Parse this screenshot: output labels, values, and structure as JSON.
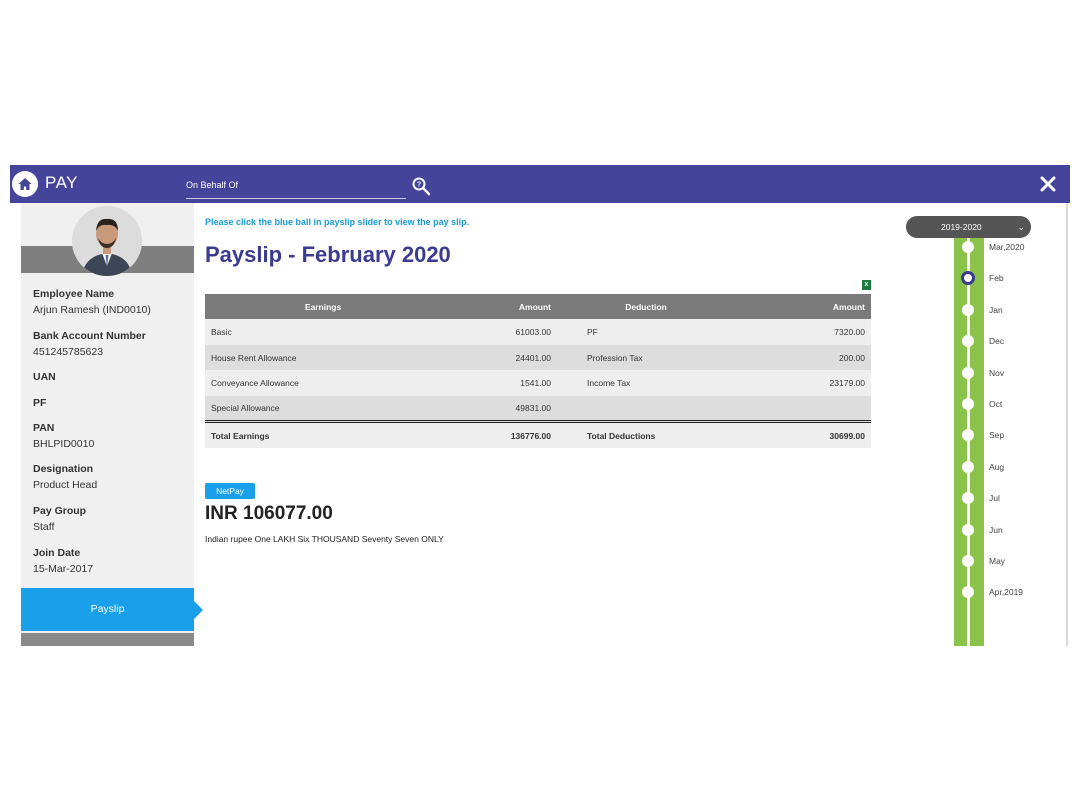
{
  "topbar": {
    "title": "PAY",
    "behalf_placeholder": "On Behalf Of",
    "home_icon": "home-icon",
    "search_icon": "search-icon",
    "close_icon": "close-icon",
    "color": "#44449a"
  },
  "profile": {
    "fields": [
      {
        "label": "Employee Name",
        "value": "Arjun Ramesh (IND0010)"
      },
      {
        "label": "Bank Account Number",
        "value": "451245785623"
      },
      {
        "label": "UAN",
        "value": ""
      },
      {
        "label": "PF",
        "value": ""
      },
      {
        "label": "PAN",
        "value": "BHLPID0010"
      },
      {
        "label": "Designation",
        "value": "Product Head"
      },
      {
        "label": "Pay Group",
        "value": "Staff"
      },
      {
        "label": "Join Date",
        "value": "15-Mar-2017"
      }
    ],
    "active_tab": "Payslip"
  },
  "main": {
    "hint": "Please click the blue ball in payslip slider to view the pay slip.",
    "title": "Payslip - February 2020",
    "table": {
      "headers": [
        "Earnings",
        "Amount",
        "Deduction",
        "Amount"
      ],
      "rows": [
        [
          "Basic",
          "61003.00",
          "PF",
          "7320.00"
        ],
        [
          "House Rent Allowance",
          "24401.00",
          "Profession Tax",
          "200.00"
        ],
        [
          "Conveyance Allowance",
          "1541.00",
          "Income Tax",
          "23179.00"
        ],
        [
          "Special Allowance",
          "49831.00",
          "",
          ""
        ]
      ],
      "totals": [
        "Total Earnings",
        "136776.00",
        "Total Deductions",
        "30699.00"
      ]
    },
    "netpay": {
      "badge": "NetPay",
      "amount": "INR 106077.00",
      "words": "Indian rupee One LAKH Six THOUSAND Seventy Seven ONLY"
    }
  },
  "timeline": {
    "year": "2019-2020",
    "months": [
      "Mar,2020",
      "Feb",
      "Jan",
      "Dec",
      "Nov",
      "Oct",
      "Sep",
      "Aug",
      "Jul",
      "Jun",
      "May",
      "Apr,2019"
    ],
    "active": "Feb",
    "color": "#8bc34a"
  },
  "colors": {
    "accent": "#1aa0ea",
    "title": "#3b3b8f",
    "table_header": "#7a7a7a"
  }
}
